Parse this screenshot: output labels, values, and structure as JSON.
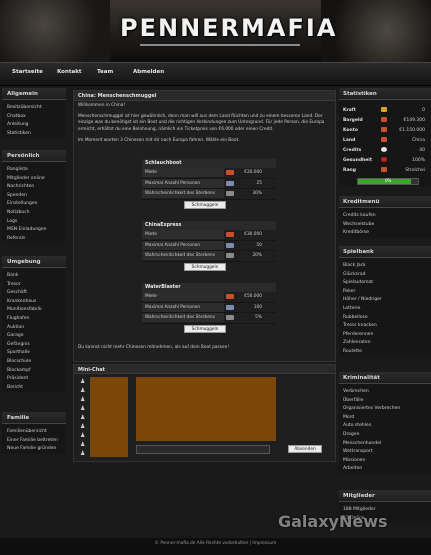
{
  "header": {
    "logo": "PENNERMAFIA"
  },
  "nav": [
    "Startseite",
    "Kontakt",
    "Team",
    "Abmelden"
  ],
  "left": {
    "allgemein": {
      "title": "Allgemein",
      "items": [
        "Besitzübersicht",
        "Chatbox",
        "Anleitung",
        "Statistiken"
      ]
    },
    "persoenlich": {
      "title": "Persönlich",
      "items": [
        "Rangliste",
        "Mitglieder online",
        "Nachrichten",
        "Spenden",
        "Einstellungen",
        "Notizbuch",
        "Logs",
        "MSN Einladungen",
        "Referals"
      ]
    },
    "umgebung": {
      "title": "Umgebung",
      "items": [
        "Bank",
        "Tresor",
        "Geschäft",
        "Krankenhaus",
        "Munitionsfabrik",
        "Flughafen",
        "Auktion",
        "Garage",
        "Gefängnis",
        "Sporthalle",
        "Blocschule",
        "Blockampf",
        "Präsident",
        "Bericht"
      ]
    },
    "familie": {
      "title": "Familie",
      "items": [
        "Familienübersicht",
        "Einer Familie beitreten",
        "Neue Familie gründen"
      ]
    }
  },
  "stats": {
    "title": "Statistiken",
    "rows": [
      {
        "label": "Kraft",
        "value": "0",
        "color": "#d9a520"
      },
      {
        "label": "Bargeld",
        "value": "€149.300",
        "color": "#c8502a"
      },
      {
        "label": "Konto",
        "value": "€1.150.000",
        "color": "#c8502a"
      },
      {
        "label": "Land",
        "value": "China",
        "color": "#c8502a"
      },
      {
        "label": "Credits",
        "value": "40",
        "color": "#e2e2e2"
      },
      {
        "label": "Gesundheit",
        "value": "100%",
        "color": "#c02020"
      },
      {
        "label": "Rang",
        "value": "Strolchei",
        "color": "#c8502a"
      }
    ],
    "progress": {
      "value": 0.88,
      "label": "0%"
    }
  },
  "kreditmenu": {
    "title": "Kreditmenü",
    "items": [
      "Credits kaufen",
      "Wechselstube",
      "Kreditbörse"
    ]
  },
  "spielbank": {
    "title": "Spielbank",
    "items": [
      "Black Jack",
      "Glücksrad",
      "Spielautomat",
      "Poker",
      "Höher / Niedriger",
      "Lotterie",
      "Rubbellose",
      "Tresor knacken",
      "Pferderennen",
      "Zahlenraten",
      "Roulette"
    ]
  },
  "kriminalitaet": {
    "title": "Kriminalität",
    "items": [
      "Verbrechen",
      "Überfälle",
      "Organisiertes Verbrechen",
      "Mord",
      "Auto stehlen",
      "Drogen",
      "Menschenhandel",
      "Wettransport",
      "Missionen",
      "Arbeiten"
    ]
  },
  "mitglieder": {
    "title": "Mitglieder",
    "items": [
      "188 Mitglieder",
      "33 Online"
    ]
  },
  "main": {
    "title": "China: Menschenschmuggel",
    "welcome": "Willkommen in China!",
    "intro": "Menschenschmuggel ist hier gewöhnlich, denn man will aus dem Land flüchten und zu einem besseren Land. Der einzige was du benötigst ist ein Boot und die richtigen Verbindungen zum Untergrund. Für jede Person, die Europa erreicht, erhältst du eine Belohnung, nämlich ein Ticketpreis von €6.000 oder einen Credit.",
    "waiting": "Im Moment warten 3 Chinesen mit dir nach Europa fahren. Wähle ein Boot.",
    "boats": [
      {
        "name": "Schlauchboot",
        "miete": "€20.000",
        "max": "25",
        "chance": "30%",
        "button": "Schmuggeln"
      },
      {
        "name": "ChinaExpress",
        "miete": "€30.000",
        "max": "50",
        "chance": "20%",
        "button": "Schmuggeln"
      },
      {
        "name": "WaterBlaster",
        "miete": "€50.000",
        "max": "100",
        "chance": "5%",
        "button": "Schmuggeln"
      }
    ],
    "labels": {
      "miete": "Miete",
      "max": "Maximal Anzahl Personen",
      "chance": "Wahrscheinlichkeit des Sterbens"
    },
    "outro": "Du kannst nicht mehr Chinesen mitnehmen, als auf dein Boot passen!"
  },
  "minichat": {
    "title": "Mini-Chat",
    "send": "Absenden"
  },
  "footer": "© Penner-mafia.de Alle Rechte vorbehalten | Impressum",
  "watermark": "GalaxyNews"
}
